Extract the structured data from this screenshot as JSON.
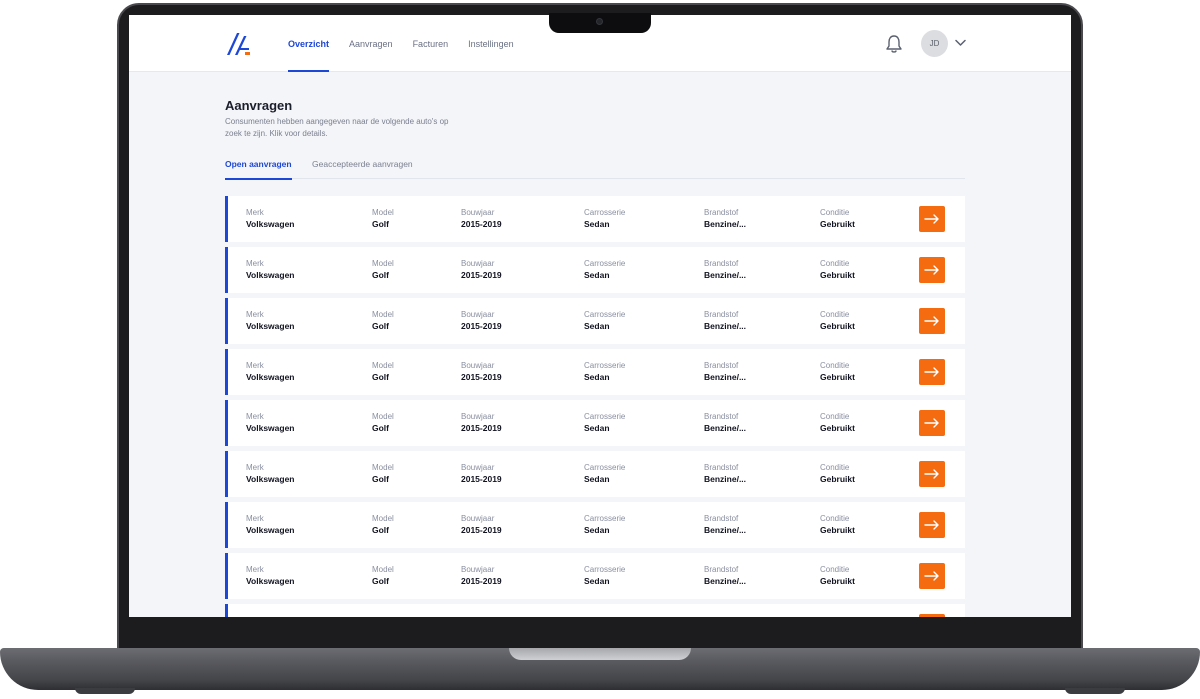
{
  "colors": {
    "accent": "#1d47d6",
    "action": "#f46b10",
    "background": "#f4f5f8"
  },
  "header": {
    "logo_icon": "brand-logo-icon",
    "nav": [
      {
        "label": "Overzicht",
        "active": true
      },
      {
        "label": "Aanvragen",
        "active": false
      },
      {
        "label": "Facturen",
        "active": false
      },
      {
        "label": "Instellingen",
        "active": false
      }
    ],
    "notification_icon": "bell-icon",
    "avatar_initials": "JD",
    "menu_icon": "chevron-down-icon"
  },
  "page": {
    "title": "Aanvragen",
    "subtitle": "Consumenten hebben aangegeven naar de volgende auto's op zoek te zijn. Klik voor details."
  },
  "tabs": [
    {
      "label": "Open aanvragen",
      "active": true
    },
    {
      "label": "Geaccepteerde aanvragen",
      "active": false
    }
  ],
  "columns": {
    "merk": "Merk",
    "model": "Model",
    "bouwjaar": "Bouwjaar",
    "carrosserie": "Carrosserie",
    "brandstof": "Brandstof",
    "conditie": "Conditie"
  },
  "requests": [
    {
      "merk": "Volkswagen",
      "model": "Golf",
      "bouwjaar": "2015-2019",
      "carrosserie": "Sedan",
      "brandstof": "Benzine/...",
      "conditie": "Gebruikt"
    },
    {
      "merk": "Volkswagen",
      "model": "Golf",
      "bouwjaar": "2015-2019",
      "carrosserie": "Sedan",
      "brandstof": "Benzine/...",
      "conditie": "Gebruikt"
    },
    {
      "merk": "Volkswagen",
      "model": "Golf",
      "bouwjaar": "2015-2019",
      "carrosserie": "Sedan",
      "brandstof": "Benzine/...",
      "conditie": "Gebruikt"
    },
    {
      "merk": "Volkswagen",
      "model": "Golf",
      "bouwjaar": "2015-2019",
      "carrosserie": "Sedan",
      "brandstof": "Benzine/...",
      "conditie": "Gebruikt"
    },
    {
      "merk": "Volkswagen",
      "model": "Golf",
      "bouwjaar": "2015-2019",
      "carrosserie": "Sedan",
      "brandstof": "Benzine/...",
      "conditie": "Gebruikt"
    },
    {
      "merk": "Volkswagen",
      "model": "Golf",
      "bouwjaar": "2015-2019",
      "carrosserie": "Sedan",
      "brandstof": "Benzine/...",
      "conditie": "Gebruikt"
    },
    {
      "merk": "Volkswagen",
      "model": "Golf",
      "bouwjaar": "2015-2019",
      "carrosserie": "Sedan",
      "brandstof": "Benzine/...",
      "conditie": "Gebruikt"
    },
    {
      "merk": "Volkswagen",
      "model": "Golf",
      "bouwjaar": "2015-2019",
      "carrosserie": "Sedan",
      "brandstof": "Benzine/...",
      "conditie": "Gebruikt"
    }
  ],
  "row_action_icon": "arrow-right-icon"
}
